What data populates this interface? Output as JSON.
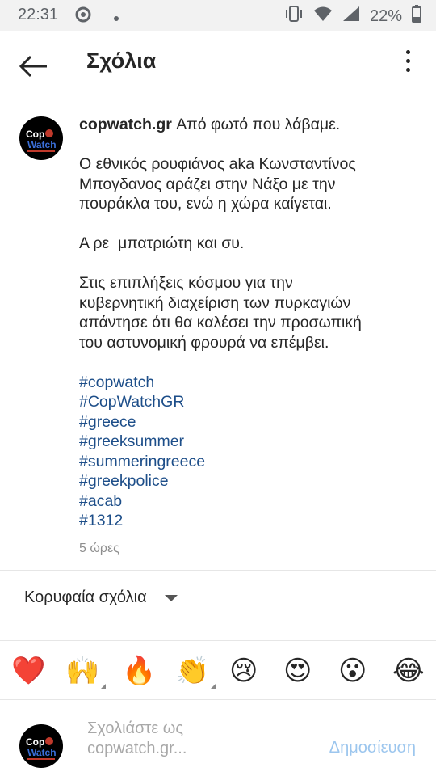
{
  "status_bar": {
    "time": "22:31",
    "battery": "22%"
  },
  "header": {
    "title": "Σχόλια"
  },
  "post": {
    "username": "copwatch.gr",
    "first_line": " Από φωτό που λάβαμε.",
    "paragraph_1_line_1": "Ο εθνικός ρουφιάνος aka Κωνσταντίνος",
    "paragraph_1_line_2": "Μπογδανος αράζει στην Νάξο με την",
    "paragraph_1_line_3": "πουράκλα του, ενώ η χώρα καίγεται.",
    "paragraph_2": "Α ρε  μπατριώτη και συ.",
    "paragraph_3_line_1": "Στις επιπλήξεις κόσμου για την",
    "paragraph_3_line_2": "κυβερνητική διαχείριση των πυρκαγιών",
    "paragraph_3_line_3": "απάντησε ότι θα καλέσει την προσωπική",
    "paragraph_3_line_4": "του αστυνομική φρουρά να επέμβει.",
    "hashtags": [
      "#copwatch",
      "#CopWatchGR",
      "#greece",
      "#greeksummer",
      "#summeringreece",
      "#greekpolice",
      "#acab",
      "#1312"
    ],
    "time": "5 ώρες",
    "avatar_text": "CopWatch"
  },
  "sort": {
    "label": "Κορυφαία σχόλια"
  },
  "emojis": [
    "❤️",
    "🙌",
    "🔥",
    "👏",
    "😢",
    "😍",
    "😮",
    "😂"
  ],
  "composer": {
    "placeholder_line_1": "Σχολιάστε ως",
    "placeholder_line_2": "copwatch.gr...",
    "post_label": "Δημοσίευση"
  }
}
